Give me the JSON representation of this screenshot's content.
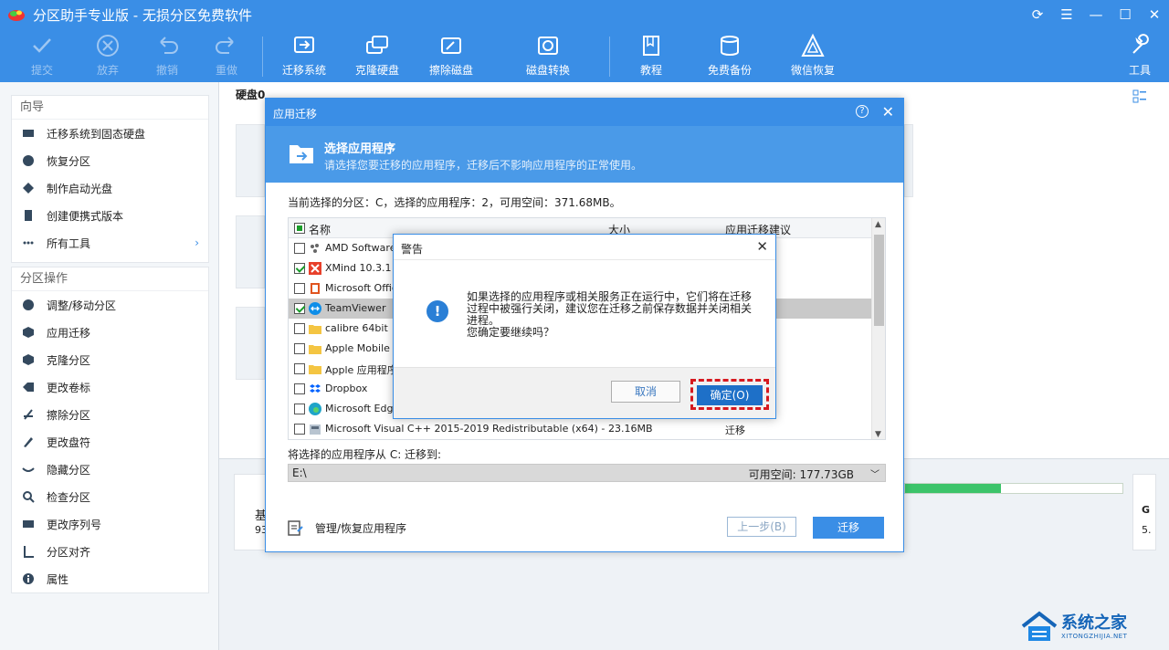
{
  "app": {
    "title": "分区助手专业版 - 无损分区免费软件",
    "brand_color": "#3a8ee6"
  },
  "toolbar": {
    "items": [
      {
        "label": "提交",
        "icon": "check-icon",
        "enabled": false
      },
      {
        "label": "放弃",
        "icon": "cancel-circle-icon",
        "enabled": false
      },
      {
        "label": "撤销",
        "icon": "undo-icon",
        "enabled": false
      },
      {
        "label": "重做",
        "icon": "redo-icon",
        "enabled": false
      },
      {
        "label": "迁移系统",
        "icon": "migrate-system-icon",
        "enabled": true
      },
      {
        "label": "克隆硬盘",
        "icon": "clone-disk-icon",
        "enabled": true
      },
      {
        "label": "擦除磁盘",
        "icon": "wipe-disk-icon",
        "enabled": true
      },
      {
        "label": "磁盘转换",
        "icon": "disk-convert-icon",
        "enabled": true
      },
      {
        "label": "教程",
        "icon": "book-icon",
        "enabled": true
      },
      {
        "label": "免费备份",
        "icon": "backup-icon",
        "enabled": true
      },
      {
        "label": "微信恢复",
        "icon": "wechat-recover-icon",
        "enabled": true
      },
      {
        "label": "工具",
        "icon": "tools-icon",
        "enabled": true
      }
    ]
  },
  "sidebar": {
    "wizard": {
      "title": "向导",
      "items": [
        {
          "label": "迁移系统到固态硬盘",
          "icon": "ssd-icon"
        },
        {
          "label": "恢复分区",
          "icon": "recover-partition-icon"
        },
        {
          "label": "制作启动光盘",
          "icon": "boot-disc-icon"
        },
        {
          "label": "创建便携式版本",
          "icon": "portable-icon"
        },
        {
          "label": "所有工具",
          "icon": "all-tools-icon"
        }
      ]
    },
    "partition_ops": {
      "title": "分区操作",
      "items": [
        {
          "label": "调整/移动分区",
          "icon": "resize-icon"
        },
        {
          "label": "应用迁移",
          "icon": "app-migrate-icon"
        },
        {
          "label": "克隆分区",
          "icon": "clone-partition-icon"
        },
        {
          "label": "更改卷标",
          "icon": "label-icon"
        },
        {
          "label": "擦除分区",
          "icon": "wipe-partition-icon"
        },
        {
          "label": "更改盘符",
          "icon": "drive-letter-icon"
        },
        {
          "label": "隐藏分区",
          "icon": "hide-icon"
        },
        {
          "label": "检查分区",
          "icon": "check-partition-icon"
        },
        {
          "label": "更改序列号",
          "icon": "serial-icon"
        },
        {
          "label": "分区对齐",
          "icon": "align-icon"
        },
        {
          "label": "属性",
          "icon": "info-icon"
        }
      ]
    }
  },
  "main": {
    "disk_label": "硬盘0",
    "bottom_left_text_1": "基",
    "bottom_left_text_2": "93",
    "bottom_right_text_1": "G",
    "bottom_right_text_2": "5."
  },
  "migrate_dialog": {
    "title": "应用迁移",
    "banner_title": "选择应用程序",
    "banner_subtitle": "请选择您要迁移的应用程序，迁移后不影响应用程序的正常使用。",
    "current_info": "当前选择的分区：C，选择的应用程序：2，可用空间：371.68MB。",
    "columns": {
      "name": "名称",
      "size": "大小",
      "suggestion": "应用迁移建议"
    },
    "rows": [
      {
        "name": "AMD Software",
        "size": "",
        "suggestion": "",
        "checked": false,
        "icon": "amd-icon"
      },
      {
        "name": "XMind 10.3.1",
        "size": "",
        "suggestion": "",
        "checked": true,
        "icon": "xmind-icon"
      },
      {
        "name": "Microsoft Office",
        "size": "",
        "suggestion": "",
        "checked": false,
        "icon": "office-icon"
      },
      {
        "name": "TeamViewer",
        "size": "",
        "suggestion": "",
        "checked": true,
        "icon": "teamviewer-icon",
        "selected": true
      },
      {
        "name": "calibre 64bit",
        "size": "",
        "suggestion": "",
        "checked": false,
        "icon": "folder-icon"
      },
      {
        "name": "Apple Mobile De",
        "size": "",
        "suggestion": "",
        "checked": false,
        "icon": "folder-icon"
      },
      {
        "name": "Apple 应用程序",
        "size": "",
        "suggestion": "",
        "checked": false,
        "icon": "folder-icon"
      },
      {
        "name": "Dropbox",
        "size": "",
        "suggestion": "",
        "checked": false,
        "icon": "dropbox-icon"
      },
      {
        "name": "Microsoft Edge",
        "size": "",
        "suggestion": "",
        "checked": false,
        "icon": "edge-icon"
      },
      {
        "name": "Microsoft Visual C++ 2015-2019 Redistributable (x64) - ...",
        "size": "23.16MB",
        "suggestion": "迁移",
        "checked": false,
        "icon": "installer-icon"
      }
    ],
    "migrate_to_label": "将选择的应用程序从 C: 迁移到:",
    "target_drive": "E:\\",
    "free_space": "可用空间:   177.73GB",
    "manage_label": "管理/恢复应用程序",
    "prev_button": "上一步(B)",
    "migrate_button": "迁移"
  },
  "warning_dialog": {
    "title": "警告",
    "message_line1": "如果选择的应用程序或相关服务正在运行中，它们将在迁移",
    "message_line2": "过程中被强行关闭，建议您在迁移之前保存数据并关闭相关",
    "message_line3": "进程。",
    "message_line4": "您确定要继续吗？",
    "cancel_button": "取消",
    "ok_button": "确定(O)"
  },
  "watermark": {
    "cn": "系统之家",
    "en": "XITONGZHIJIA.NET"
  }
}
